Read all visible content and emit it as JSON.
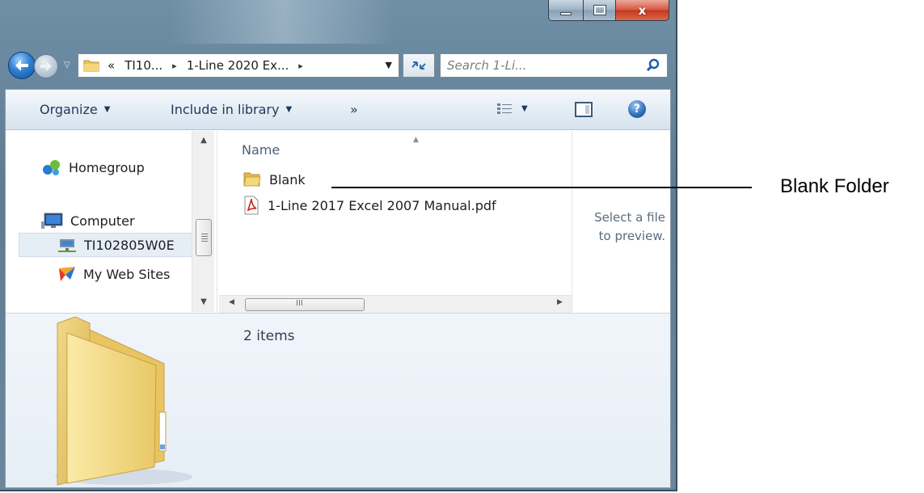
{
  "window": {
    "caption_buttons": {
      "minimize": "minimize",
      "maximize": "maximize",
      "close": "x"
    }
  },
  "address_bar": {
    "overflow": "«",
    "crumbs": [
      "TI10...",
      "1-Line 2020 Ex..."
    ],
    "separator": "▸"
  },
  "search": {
    "placeholder": "Search 1-Li..."
  },
  "toolbar": {
    "organize_label": "Organize",
    "include_label": "Include in library",
    "more_label": "»"
  },
  "nav_pane": {
    "items": [
      {
        "label": "Homegroup",
        "icon": "homegroup-icon"
      },
      {
        "label": "Computer",
        "icon": "computer-icon"
      },
      {
        "label": "TI102805W0E",
        "icon": "network-drive-icon",
        "selected": true
      },
      {
        "label": "My Web Sites",
        "icon": "web-sites-icon"
      }
    ]
  },
  "file_list": {
    "column_header": "Name",
    "files": [
      {
        "name": "Blank",
        "icon": "folder-icon"
      },
      {
        "name": "1-Line 2017 Excel 2007 Manual.pdf",
        "icon": "pdf-icon"
      }
    ],
    "scroll_grip": "III"
  },
  "preview_pane": {
    "message_line1": "Select a file",
    "message_line2": "to preview."
  },
  "details_pane": {
    "item_count": "2 items"
  },
  "annotation": {
    "label": "Blank Folder"
  },
  "colors": {
    "folder_yellow": "#f3d77a",
    "toolbar_text": "#1e395b",
    "nav_blue": "#2e7fd3",
    "close_red": "#c5371c"
  }
}
